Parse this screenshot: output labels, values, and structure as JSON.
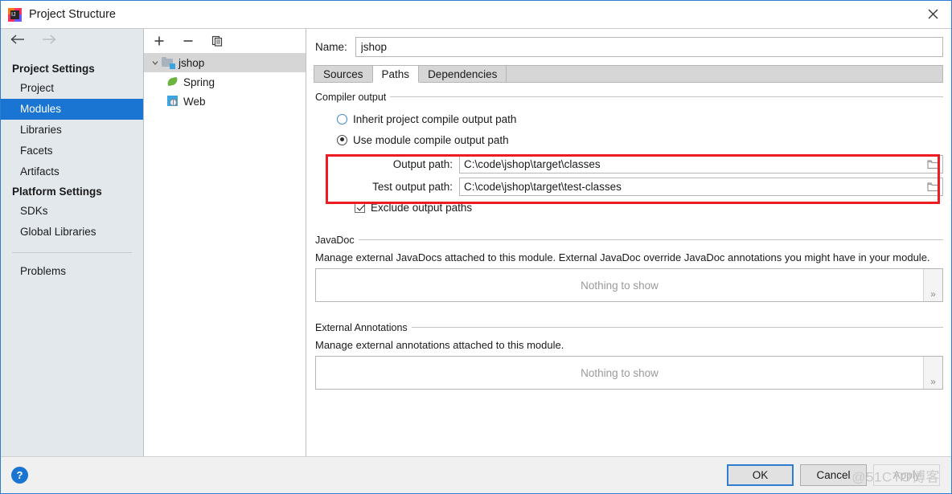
{
  "window": {
    "title": "Project Structure",
    "logo_icon": "intellij-idea-logo",
    "close_icon": "close-icon"
  },
  "sidebar": {
    "back_icon": "arrow-left-icon",
    "forward_icon": "arrow-right-icon",
    "groups": [
      {
        "label": "Project Settings",
        "items": [
          {
            "label": "Project",
            "selected": false
          },
          {
            "label": "Modules",
            "selected": true
          },
          {
            "label": "Libraries",
            "selected": false
          },
          {
            "label": "Facets",
            "selected": false
          },
          {
            "label": "Artifacts",
            "selected": false
          }
        ]
      },
      {
        "label": "Platform Settings",
        "items": [
          {
            "label": "SDKs",
            "selected": false
          },
          {
            "label": "Global Libraries",
            "selected": false
          }
        ]
      }
    ],
    "problems_label": "Problems"
  },
  "tree": {
    "toolbar": {
      "add_icon": "plus-icon",
      "remove_icon": "minus-icon",
      "copy_icon": "copy-icon"
    },
    "nodes": [
      {
        "label": "jshop",
        "icon": "module-icon",
        "selected": true,
        "expanded": true,
        "indent": false
      },
      {
        "label": "Spring",
        "icon": "spring-icon",
        "selected": false,
        "indent": true
      },
      {
        "label": "Web",
        "icon": "web-icon",
        "selected": false,
        "indent": true
      }
    ]
  },
  "main": {
    "name_label": "Name:",
    "name_value": "jshop",
    "name_placeholder": "",
    "tabs": [
      {
        "label": "Sources",
        "active": false
      },
      {
        "label": "Paths",
        "active": true
      },
      {
        "label": "Dependencies",
        "active": false
      }
    ],
    "compiler_output": {
      "group_title": "Compiler output",
      "inherit_label": "Inherit project compile output path",
      "inherit_selected": false,
      "module_label": "Use module compile output path",
      "module_selected": true,
      "output_path_label": "Output path:",
      "output_path_value": "C:\\code\\jshop\\target\\classes",
      "test_output_path_label": "Test output path:",
      "test_output_path_value": "C:\\code\\jshop\\target\\test-classes",
      "browse_icon": "folder-browse-icon",
      "exclude_label": "Exclude output paths",
      "exclude_checked": true,
      "highlight_color": "#ee1b22"
    },
    "javadoc": {
      "group_title": "JavaDoc",
      "description": "Manage external JavaDocs attached to this module. External JavaDoc override JavaDoc annotations you might have in your module.",
      "empty_text": "Nothing to show",
      "expander_label": "»"
    },
    "external_annotations": {
      "group_title": "External Annotations",
      "description": "Manage external annotations attached to this module.",
      "empty_text": "Nothing to show",
      "expander_label": "»"
    }
  },
  "footer": {
    "help_icon": "help-icon",
    "help_label": "?",
    "ok_label": "OK",
    "cancel_label": "Cancel",
    "apply_label": "Apply",
    "watermark": "@51CTO博客"
  }
}
